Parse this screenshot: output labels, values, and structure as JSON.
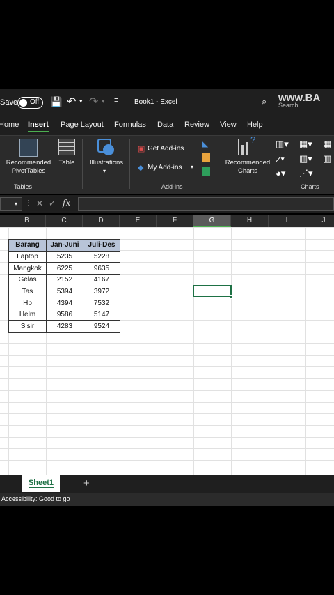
{
  "titlebar": {
    "autosave_label": "Save",
    "autosave_state": "Off",
    "doc_title": "Book1  -  Excel",
    "search_placeholder": "Search",
    "watermark": "www.BA"
  },
  "ribbon_tabs": [
    "Home",
    "Insert",
    "Page Layout",
    "Formulas",
    "Data",
    "Review",
    "View",
    "Help"
  ],
  "active_tab": "Insert",
  "ribbon": {
    "tables": {
      "recommended_pivot_line1": "Recommended",
      "recommended_pivot_line2": "PivotTables",
      "table": "Table",
      "group": "Tables"
    },
    "illustrations": {
      "label": "Illustrations"
    },
    "addins": {
      "get": "Get Add-ins",
      "my": "My Add-ins",
      "group": "Add-ins"
    },
    "charts": {
      "recommended_line1": "Recommended",
      "recommended_line2": "Charts",
      "group": "Charts"
    }
  },
  "formula_bar": {
    "fx": "fx",
    "cancel": "✕",
    "enter": "✓",
    "value": ""
  },
  "columns": [
    "B",
    "C",
    "D",
    "E",
    "F",
    "G",
    "H",
    "I",
    "J"
  ],
  "selected_column": "G",
  "table": {
    "headers": [
      "Barang",
      "Jan-Juni",
      "Juli-Des"
    ],
    "rows": [
      [
        "Laptop",
        "5235",
        "5228"
      ],
      [
        "Mangkok",
        "6225",
        "9635"
      ],
      [
        "Gelas",
        "2152",
        "4167"
      ],
      [
        "Tas",
        "5394",
        "3972"
      ],
      [
        "Hp",
        "4394",
        "7532"
      ],
      [
        "Helm",
        "9586",
        "5147"
      ],
      [
        "Sisir",
        "4283",
        "9524"
      ]
    ]
  },
  "sheet_tabs": {
    "active": "Sheet1",
    "add": "+"
  },
  "status": {
    "accessibility": "Accessibility: Good to go"
  },
  "colors": {
    "accent_green": "#1e7145",
    "header_fill": "#b8c4d8"
  }
}
